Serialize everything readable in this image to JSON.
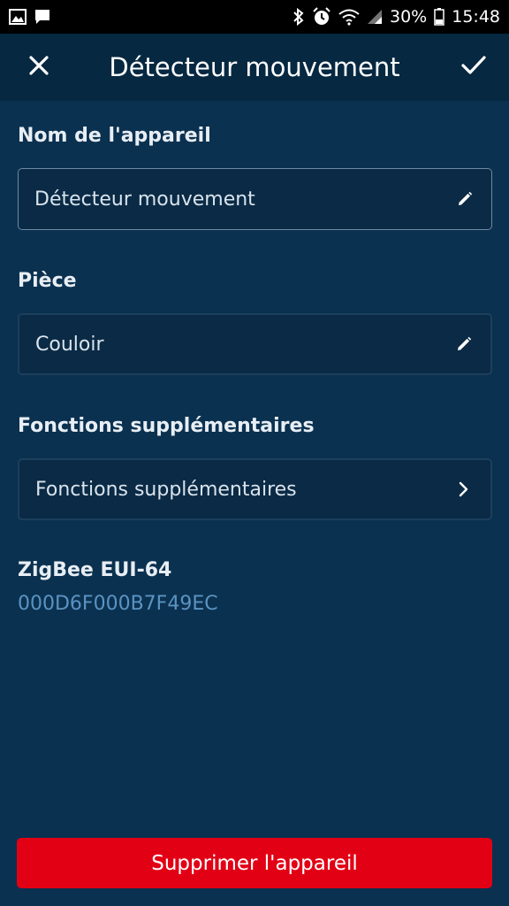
{
  "status_bar": {
    "battery_percent": "30%",
    "time": "15:48",
    "icons": [
      "image-icon",
      "message-icon",
      "bluetooth-icon",
      "alarm-icon",
      "wifi-icon",
      "signal-icon",
      "battery-icon"
    ]
  },
  "app_bar": {
    "title": "Détecteur mouvement",
    "close_icon": "close-icon",
    "confirm_icon": "check-icon"
  },
  "form": {
    "device_name": {
      "label": "Nom de l'appareil",
      "value": "Détecteur mouvement",
      "icon": "pencil-icon"
    },
    "room": {
      "label": "Pièce",
      "value": "Couloir",
      "icon": "pencil-icon"
    },
    "extra_functions": {
      "label": "Fonctions supplémentaires",
      "value": "Fonctions supplémentaires",
      "icon": "chevron-right-icon"
    },
    "zigbee": {
      "label": "ZigBee EUI-64",
      "value": "000D6F000B7F49EC"
    }
  },
  "actions": {
    "delete_label": "Supprimer l'appareil"
  },
  "colors": {
    "background": "#0b3150",
    "app_bar": "#062841",
    "accent_red": "#e20015",
    "eui_value": "#5a93c2"
  }
}
